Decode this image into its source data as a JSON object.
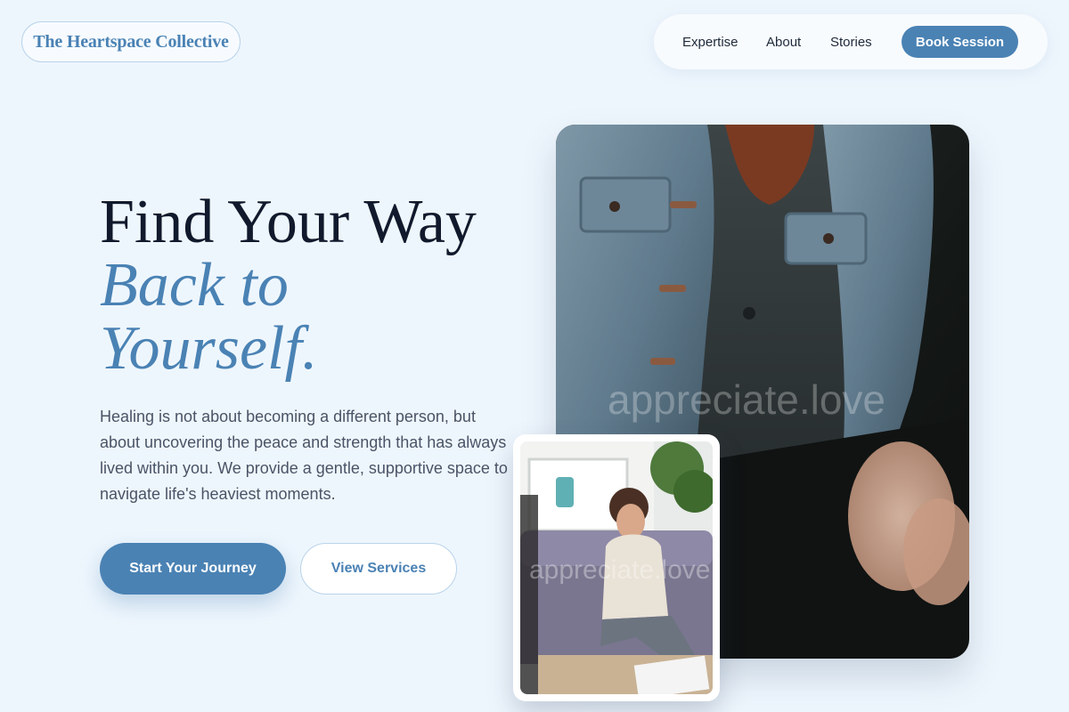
{
  "brand": {
    "name": "The Heartspace Collective"
  },
  "nav": {
    "links": [
      "Expertise",
      "About",
      "Stories"
    ],
    "cta": "Book Session"
  },
  "hero": {
    "headline_line1": "Find Your Way",
    "headline_line2": "Back to",
    "headline_line3": "Yourself.",
    "description": "Healing is not about becoming a different person, but about uncovering the peace and strength that has always lived within you. We provide a gentle, supportive space to navigate life's heaviest moments.",
    "primary_cta": "Start Your Journey",
    "secondary_cta": "View Services"
  },
  "images": {
    "main_watermark": "appreciate.love",
    "inset_watermark": "appreciate.love"
  },
  "colors": {
    "accent": "#4a82b4",
    "background": "#eef6fd",
    "heading": "#111a2c",
    "body_text": "#4a5466"
  }
}
